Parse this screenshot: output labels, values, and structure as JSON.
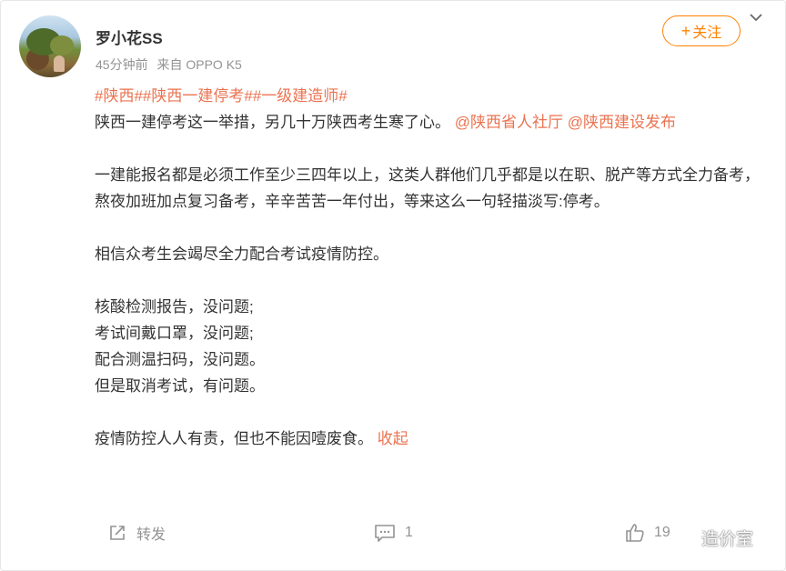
{
  "post": {
    "username": "罗小花SS",
    "time": "45分钟前",
    "source": "来自 OPPO K5",
    "follow_label": "关注",
    "hashtags": [
      "#陕西#",
      "#陕西一建停考#",
      "#一级建造师#"
    ],
    "p1_text": "陕西一建停考这一举措，另几十万陕西考生寒了心。",
    "mention1": "@陕西省人社厅",
    "mention2": "@陕西建设发布",
    "p2": "一建能报名都是必须工作至少三四年以上，这类人群他们几乎都是以在职、脱产等方式全力备考，熬夜加班加点复习备考，辛辛苦苦一年付出，等来这么一句轻描淡写:停考。",
    "p3": "相信众考生会竭尽全力配合考试疫情防控。",
    "lines": [
      "核酸检测报告，没问题;",
      "考试间戴口罩，没问题;",
      "配合测温扫码，没问题。",
      "但是取消考试，有问题。"
    ],
    "p5": "疫情防控人人有责，但也不能因噎废食。",
    "collapse_label": "收起"
  },
  "actions": {
    "repost_label": "转发",
    "comment_count": "1",
    "like_count": "19"
  },
  "watermark": {
    "text": "造价室"
  },
  "colors": {
    "accent": "#ff8200",
    "link": "#eb7350",
    "meta": "#939393"
  }
}
